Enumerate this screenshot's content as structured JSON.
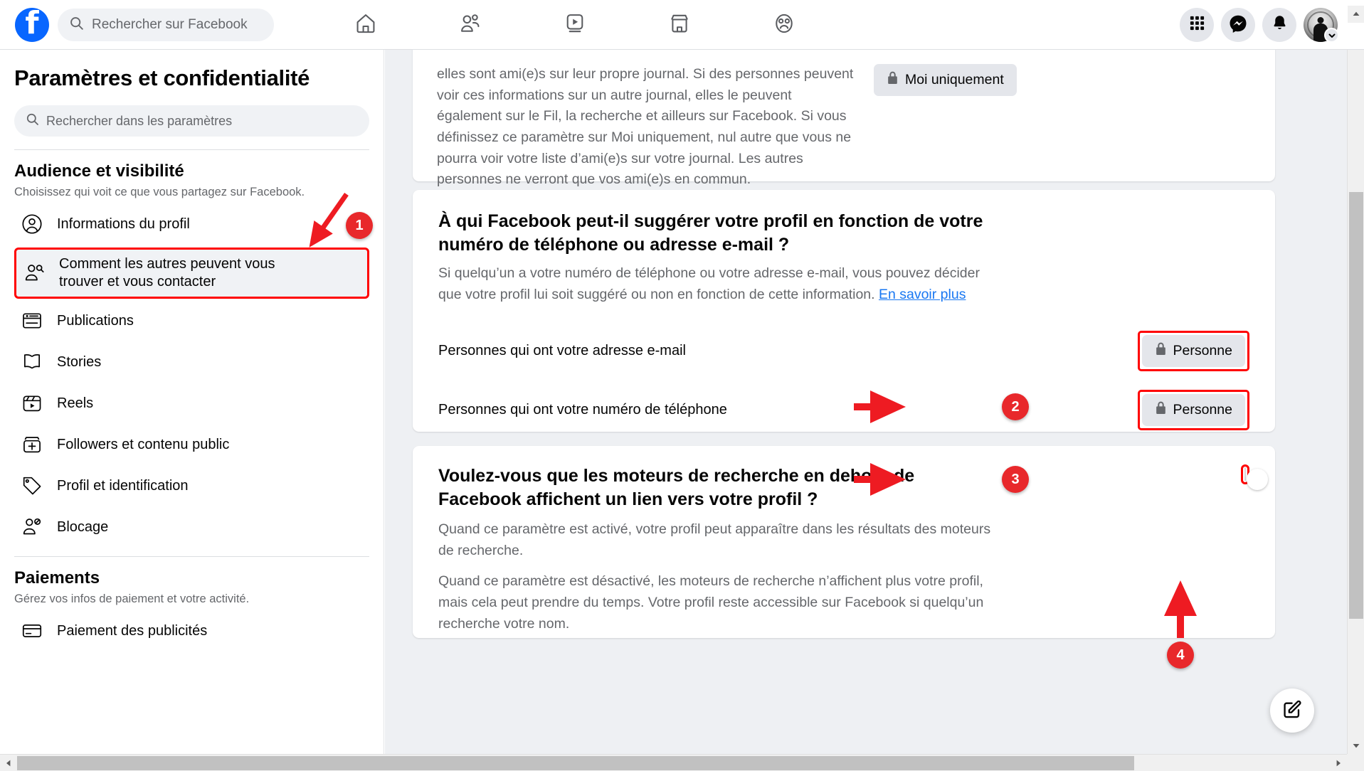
{
  "topbar": {
    "logo_alt": "facebook-logo",
    "search": {
      "placeholder": "Rechercher sur Facebook",
      "value": ""
    },
    "nav": [
      {
        "name": "home-icon",
        "label": "Accueil"
      },
      {
        "name": "friends-icon",
        "label": "Ami(e)s"
      },
      {
        "name": "video-icon",
        "label": "Vidéo"
      },
      {
        "name": "marketplace-icon",
        "label": "Marketplace"
      },
      {
        "name": "groups-icon",
        "label": "Groupes"
      }
    ],
    "actions": [
      {
        "name": "menu-grid-icon",
        "label": "Menu"
      },
      {
        "name": "messenger-icon",
        "label": "Messenger"
      },
      {
        "name": "notifications-bell-icon",
        "label": "Notifications"
      },
      {
        "name": "account-avatar",
        "label": "Compte"
      }
    ]
  },
  "sidebar": {
    "title": "Paramètres et confidentialité",
    "search": {
      "placeholder": "Rechercher dans les paramètres",
      "value": ""
    },
    "sections": [
      {
        "title": "Audience et visibilité",
        "subtitle": "Choisissez qui voit ce que vous partagez sur Facebook.",
        "items": [
          {
            "label": "Informations du profil",
            "icon": "profile-circle-icon",
            "selected": false
          },
          {
            "label": "Comment les autres peuvent vous trouver et vous contacter",
            "icon": "find-contact-icon",
            "selected": true
          },
          {
            "label": "Publications",
            "icon": "posts-icon",
            "selected": false
          },
          {
            "label": "Stories",
            "icon": "stories-book-icon",
            "selected": false
          },
          {
            "label": "Reels",
            "icon": "reels-icon",
            "selected": false
          },
          {
            "label": "Followers et contenu public",
            "icon": "followers-plus-icon",
            "selected": false
          },
          {
            "label": "Profil et identification",
            "icon": "tag-icon",
            "selected": false
          },
          {
            "label": "Blocage",
            "icon": "block-user-icon",
            "selected": false
          }
        ]
      },
      {
        "title": "Paiements",
        "subtitle": "Gérez vos infos de paiement et votre activité.",
        "items": [
          {
            "label": "Paiement des publicités",
            "icon": "credit-card-icon",
            "selected": false
          }
        ]
      }
    ]
  },
  "main": {
    "card_friends": {
      "paragraph": "elles sont ami(e)s sur leur propre journal. Si des personnes peuvent voir ces informations sur un autre journal, elles le peuvent également sur le Fil, la recherche et ailleurs sur Facebook. Si vous définissez ce paramètre sur Moi uniquement, nul autre que vous ne pourra voir votre liste d’ami(e)s sur votre journal. Les autres personnes ne verront que vos ami(e)s en commun.",
      "audience_button": {
        "label": "Moi uniquement",
        "icon": "lock-icon"
      }
    },
    "card_suggest": {
      "heading": "À qui Facebook peut-il suggérer votre profil en fonction de votre numéro de téléphone ou adresse e-mail ?",
      "description_part1": "Si quelqu’un a votre numéro de téléphone ou votre adresse e-mail, vous pouvez décider que votre profil lui soit suggéré ou non en fonction de cette information. ",
      "description_link": "En savoir plus",
      "rows": [
        {
          "label": "Personnes qui ont votre adresse e-mail",
          "button": {
            "label": "Personne",
            "icon": "lock-icon"
          }
        },
        {
          "label": "Personnes qui ont votre numéro de téléphone",
          "button": {
            "label": "Personne",
            "icon": "lock-icon"
          }
        }
      ]
    },
    "card_search_engines": {
      "heading": "Voulez-vous que les moteurs de recherche en dehors de Facebook affichent un lien vers votre profil ?",
      "paragraph1": "Quand ce paramètre est activé, votre profil peut apparaître dans les résultats des moteurs de recherche.",
      "paragraph2": "Quand ce paramètre est désactivé, les moteurs de recherche n’affichent plus votre profil, mais cela peut prendre du temps. Votre profil reste accessible sur Facebook si quelqu’un recherche votre nom.",
      "toggle": {
        "name": "search-engine-link-toggle",
        "state": "off"
      }
    },
    "compose_button": {
      "icon": "compose-pencil-icon",
      "label": "Écrire"
    }
  },
  "annotations": {
    "markers": [
      {
        "number": "1",
        "target": "sidebar-item-comment-les-autres"
      },
      {
        "number": "2",
        "target": "email-audience-button"
      },
      {
        "number": "3",
        "target": "phone-audience-button"
      },
      {
        "number": "4",
        "target": "search-engine-link-toggle"
      }
    ],
    "highlight_color": "#ff0000",
    "marker_color": "#e8282b"
  },
  "scrollbars": {
    "vertical": {
      "name": "vertical-scrollbar",
      "position_percent": 22
    },
    "horizontal": {
      "name": "horizontal-scrollbar",
      "position_percent": 0
    }
  }
}
